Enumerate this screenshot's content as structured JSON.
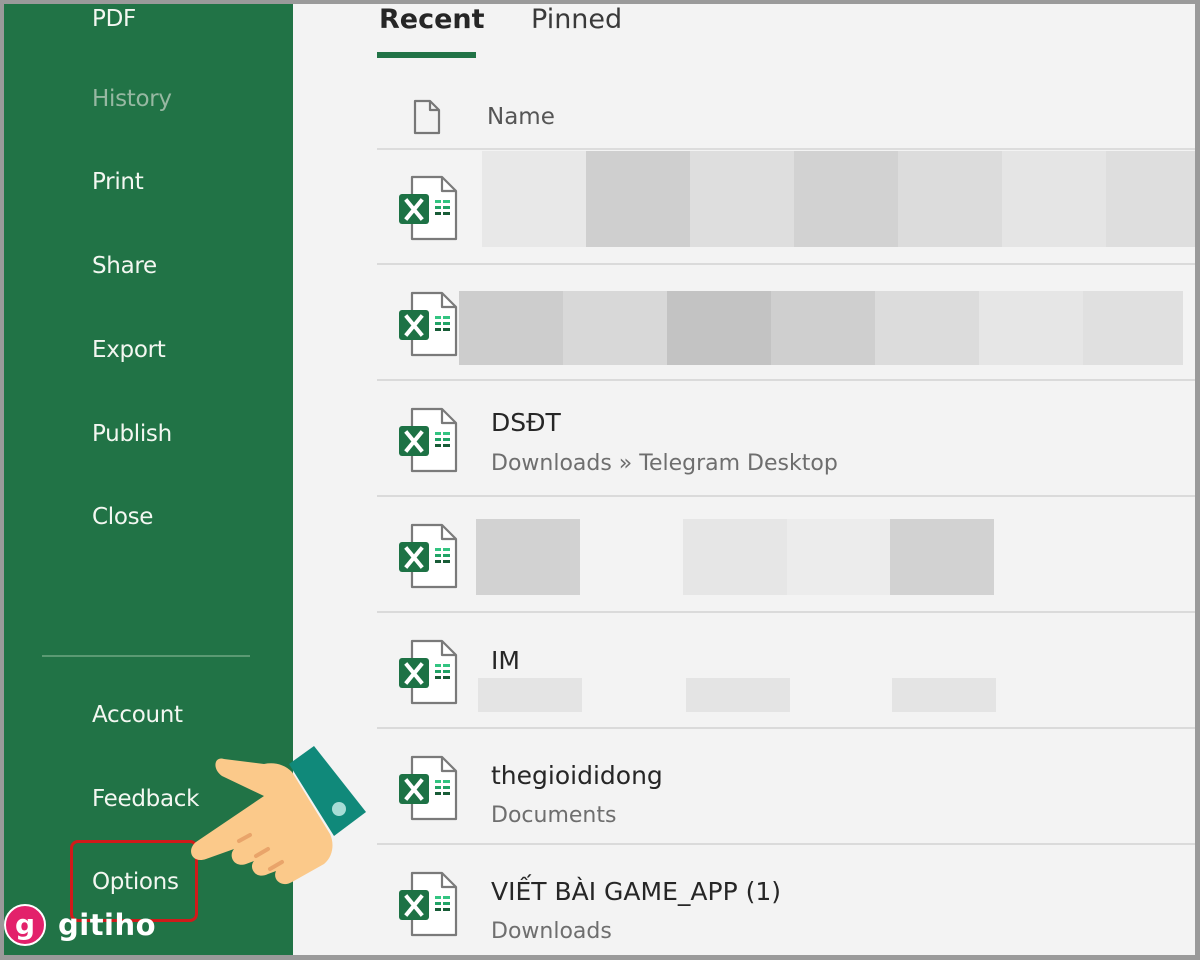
{
  "sidebar": {
    "items": [
      {
        "label": "PDF",
        "disabled": false
      },
      {
        "label": "History",
        "disabled": true
      },
      {
        "label": "Print",
        "disabled": false
      },
      {
        "label": "Share",
        "disabled": false
      },
      {
        "label": "Export",
        "disabled": false
      },
      {
        "label": "Publish",
        "disabled": false
      },
      {
        "label": "Close",
        "disabled": false
      }
    ],
    "bottom_items": [
      {
        "label": "Account"
      },
      {
        "label": "Feedback"
      },
      {
        "label": "Options",
        "highlighted": true
      }
    ]
  },
  "tabs": [
    {
      "label": "Recent",
      "active": true
    },
    {
      "label": "Pinned",
      "active": false
    }
  ],
  "columns": {
    "name": "Name",
    "icon": "file-icon"
  },
  "files": [
    {
      "name": "",
      "path": "",
      "redacted": true,
      "icon": "excel-icon"
    },
    {
      "name": "",
      "path": "",
      "redacted": true,
      "icon": "excel-icon"
    },
    {
      "name": "DSĐT",
      "path": "Downloads » Telegram Desktop",
      "icon": "excel-icon"
    },
    {
      "name": "",
      "path": "",
      "redacted": true,
      "icon": "excel-icon"
    },
    {
      "name": "IM",
      "path": "",
      "redacted_path": true,
      "icon": "excel-icon"
    },
    {
      "name": "thegioididong",
      "path": "Documents",
      "icon": "excel-icon"
    },
    {
      "name": "VIẾT BÀI GAME_APP (1)",
      "path": "Downloads",
      "icon": "excel-icon"
    }
  ],
  "watermark": {
    "badge": "g",
    "text": "gitiho"
  },
  "colors": {
    "sidebar": "#217346",
    "accent": "#217346",
    "highlight": "#d01a1a",
    "watermark": "#e3216b"
  }
}
